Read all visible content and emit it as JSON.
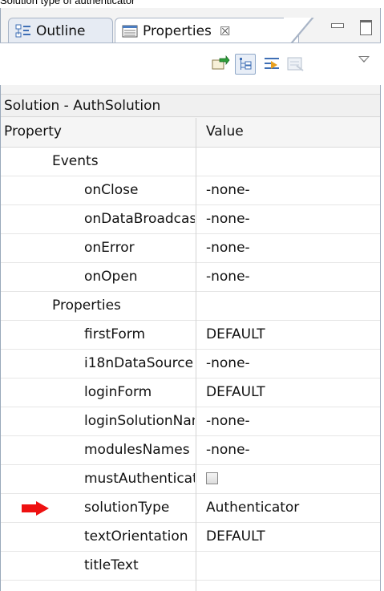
{
  "caption": "Solution type of authenticator",
  "tabs": {
    "outline_label": "Outline",
    "properties_label": "Properties",
    "close_symbol": "☒"
  },
  "toolbar": {
    "buttons": [
      "pin-editor-icon",
      "show-categories-icon",
      "show-advanced-icon",
      "restore-default-icon"
    ],
    "menu": "view-menu-icon"
  },
  "panel": {
    "title": "Solution - AuthSolution",
    "columns": {
      "property": "Property",
      "value": "Value"
    }
  },
  "rows": [
    {
      "type": "category",
      "name": "Events",
      "value": ""
    },
    {
      "type": "property",
      "name": "onClose",
      "value": "-none-"
    },
    {
      "type": "property",
      "name": "onDataBroadcast",
      "value": "-none-"
    },
    {
      "type": "property",
      "name": "onError",
      "value": "-none-"
    },
    {
      "type": "property",
      "name": "onOpen",
      "value": "-none-"
    },
    {
      "type": "category",
      "name": "Properties",
      "value": ""
    },
    {
      "type": "property",
      "name": "firstForm",
      "value": "DEFAULT"
    },
    {
      "type": "property",
      "name": "i18nDataSource",
      "value": "-none-"
    },
    {
      "type": "property",
      "name": "loginForm",
      "value": "DEFAULT"
    },
    {
      "type": "property",
      "name": "loginSolutionName",
      "value": "-none-"
    },
    {
      "type": "property",
      "name": "modulesNames",
      "value": "-none-"
    },
    {
      "type": "property",
      "name": "mustAuthenticate",
      "value": "",
      "checkbox": false
    },
    {
      "type": "property",
      "name": "solutionType",
      "value": "Authenticator",
      "highlighted": true
    },
    {
      "type": "property",
      "name": "textOrientation",
      "value": "DEFAULT"
    },
    {
      "type": "property",
      "name": "titleText",
      "value": ""
    }
  ],
  "colors": {
    "arrow": "#ee1111",
    "tab_border": "#a8b4c6"
  }
}
